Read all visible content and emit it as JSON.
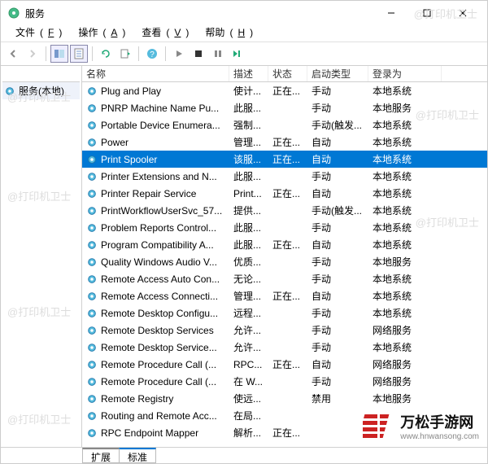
{
  "window": {
    "title": "服务"
  },
  "menu": {
    "file": "文件",
    "file_key": "F",
    "action": "操作",
    "action_key": "A",
    "view": "查看",
    "view_key": "V",
    "help": "帮助",
    "help_key": "H"
  },
  "sidebar": {
    "root": "服务(本地)"
  },
  "columns": {
    "name": "名称",
    "desc": "描述",
    "status": "状态",
    "startup": "启动类型",
    "logon": "登录为"
  },
  "tabs": {
    "extended": "扩展",
    "standard": "标准"
  },
  "services": [
    {
      "name": "Plug and Play",
      "desc": "使计...",
      "status": "正在...",
      "startup": "手动",
      "logon": "本地系统",
      "selected": false
    },
    {
      "name": "PNRP Machine Name Pu...",
      "desc": "此服...",
      "status": "",
      "startup": "手动",
      "logon": "本地服务",
      "selected": false
    },
    {
      "name": "Portable Device Enumera...",
      "desc": "强制...",
      "status": "",
      "startup": "手动(触发...",
      "logon": "本地系统",
      "selected": false
    },
    {
      "name": "Power",
      "desc": "管理...",
      "status": "正在...",
      "startup": "自动",
      "logon": "本地系统",
      "selected": false
    },
    {
      "name": "Print Spooler",
      "desc": "该服...",
      "status": "正在...",
      "startup": "自动",
      "logon": "本地系统",
      "selected": true
    },
    {
      "name": "Printer Extensions and N...",
      "desc": "此服...",
      "status": "",
      "startup": "手动",
      "logon": "本地系统",
      "selected": false
    },
    {
      "name": "Printer Repair Service",
      "desc": "Print...",
      "status": "正在...",
      "startup": "自动",
      "logon": "本地系统",
      "selected": false
    },
    {
      "name": "PrintWorkflowUserSvc_57...",
      "desc": "提供...",
      "status": "",
      "startup": "手动(触发...",
      "logon": "本地系统",
      "selected": false
    },
    {
      "name": "Problem Reports Control...",
      "desc": "此服...",
      "status": "",
      "startup": "手动",
      "logon": "本地系统",
      "selected": false
    },
    {
      "name": "Program Compatibility A...",
      "desc": "此服...",
      "status": "正在...",
      "startup": "自动",
      "logon": "本地系统",
      "selected": false
    },
    {
      "name": "Quality Windows Audio V...",
      "desc": "优质...",
      "status": "",
      "startup": "手动",
      "logon": "本地服务",
      "selected": false
    },
    {
      "name": "Remote Access Auto Con...",
      "desc": "无论...",
      "status": "",
      "startup": "手动",
      "logon": "本地系统",
      "selected": false
    },
    {
      "name": "Remote Access Connecti...",
      "desc": "管理...",
      "status": "正在...",
      "startup": "自动",
      "logon": "本地系统",
      "selected": false
    },
    {
      "name": "Remote Desktop Configu...",
      "desc": "远程...",
      "status": "",
      "startup": "手动",
      "logon": "本地系统",
      "selected": false
    },
    {
      "name": "Remote Desktop Services",
      "desc": "允许...",
      "status": "",
      "startup": "手动",
      "logon": "网络服务",
      "selected": false
    },
    {
      "name": "Remote Desktop Service...",
      "desc": "允许...",
      "status": "",
      "startup": "手动",
      "logon": "本地系统",
      "selected": false
    },
    {
      "name": "Remote Procedure Call (...",
      "desc": "RPC...",
      "status": "正在...",
      "startup": "自动",
      "logon": "网络服务",
      "selected": false
    },
    {
      "name": "Remote Procedure Call (...",
      "desc": "在 W...",
      "status": "",
      "startup": "手动",
      "logon": "网络服务",
      "selected": false
    },
    {
      "name": "Remote Registry",
      "desc": "使远...",
      "status": "",
      "startup": "禁用",
      "logon": "本地服务",
      "selected": false
    },
    {
      "name": "Routing and Remote Acc...",
      "desc": "在局...",
      "status": "",
      "startup": "",
      "logon": "",
      "selected": false
    },
    {
      "name": "RPC Endpoint Mapper",
      "desc": "解析...",
      "status": "正在...",
      "startup": "",
      "logon": "",
      "selected": false
    }
  ],
  "watermarks": [
    "@打印机卫士",
    "@打印机卫士",
    "@打印机卫士",
    "@打印机卫士",
    "@打印机卫士",
    "@打印机卫士",
    "@打印机卫士"
  ],
  "brand": {
    "name": "万松手游网",
    "url": "www.hnwansong.com"
  },
  "icons": {
    "gear": "gear-icon",
    "back": "back-icon",
    "fwd": "forward-icon",
    "up": "up-icon",
    "panes": "panes-icon",
    "props": "properties-icon",
    "refresh": "refresh-icon",
    "export": "export-icon",
    "help": "help-icon",
    "play": "play-icon",
    "stop": "stop-icon",
    "pause": "pause-icon",
    "restart": "restart-icon"
  }
}
